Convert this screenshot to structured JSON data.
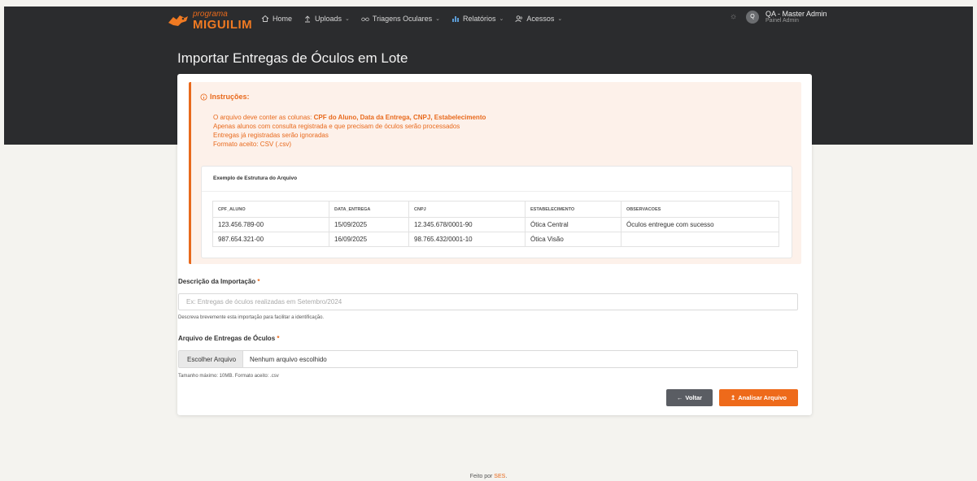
{
  "brand": {
    "line1": "programa",
    "line2": "MIGUILIM"
  },
  "nav": [
    {
      "icon": "home-icon",
      "label": "Home",
      "dropdown": false
    },
    {
      "icon": "upload-icon",
      "label": "Uploads",
      "dropdown": true
    },
    {
      "icon": "glasses-icon",
      "label": "Triagens Oculares",
      "dropdown": true
    },
    {
      "icon": "bar-chart-icon",
      "label": "Relatórios",
      "dropdown": true
    },
    {
      "icon": "users-icon",
      "label": "Acessos",
      "dropdown": true
    }
  ],
  "user": {
    "initial": "Q",
    "name": "QA - Master Admin",
    "role": "Painel Admin"
  },
  "page": {
    "title": "Importar Entregas de Óculos em Lote"
  },
  "instructions": {
    "title": "Instruções:",
    "line1_prefix": "O arquivo deve conter as colunas: ",
    "line1_bold": "CPF do Aluno, Data da Entrega, CNPJ, Estabelecimento",
    "line2": "Apenas alunos com consulta registrada e que precisam de óculos serão processados",
    "line3": "Entregas já registradas serão ignoradas",
    "line4": "Formato aceito: CSV (.csv)"
  },
  "example": {
    "title": "Exemplo de Estrutura do Arquivo",
    "headers": [
      "CPF_ALUNO",
      "DATA_ENTREGA",
      "CNPJ",
      "ESTABELECIMENTO",
      "OBSERVACOES"
    ],
    "rows": [
      [
        "123.456.789-00",
        "15/09/2025",
        "12.345.678/0001-90",
        "Ótica Central",
        "Óculos entregue com sucesso"
      ],
      [
        "987.654.321-00",
        "16/09/2025",
        "98.765.432/0001-10",
        "Ótica Visão",
        ""
      ]
    ]
  },
  "form": {
    "desc_label": "Descrição da Importação",
    "required_mark": "*",
    "desc_placeholder": "Ex: Entregas de óculos realizadas em Setembro/2024",
    "desc_help": "Descreva brevemente esta importação para facilitar a identificação.",
    "file_label": "Arquivo de Entregas de Óculos",
    "file_button": "Escolher Arquivo",
    "file_none": "Nenhum arquivo escolhido",
    "file_help": "Tamanho máximo: 10MB. Formato aceito: .csv"
  },
  "buttons": {
    "back": "Voltar",
    "analyze": "Analisar Arquivo"
  },
  "footer": {
    "prefix": "Feito por ",
    "link": "SES",
    "suffix": "."
  }
}
